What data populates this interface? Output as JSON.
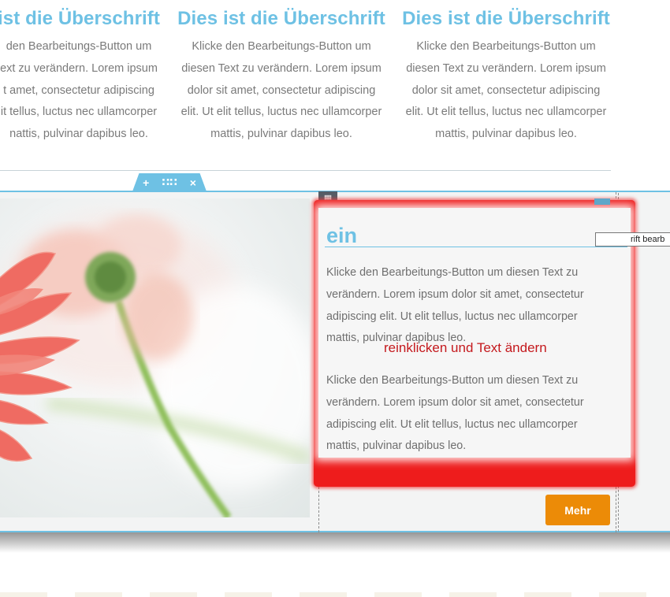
{
  "top_columns": [
    {
      "heading": "ist die Überschrift",
      "lines": [
        "den Bearbeitungs-Button um",
        "ext zu verändern. Lorem ipsum",
        "t amet, consectetur adipiscing",
        "it tellus, luctus nec ullamcorper",
        "nattis, pulvinar dapibus leo."
      ]
    },
    {
      "heading": "Dies ist die Überschrift",
      "lines": [
        "Klicke den Bearbeitungs-Button um",
        "diesen Text zu verändern. Lorem ipsum",
        "dolor sit amet, consectetur adipiscing",
        "elit. Ut elit tellus, luctus nec ullamcorper",
        "mattis, pulvinar dapibus leo."
      ]
    },
    {
      "heading": "Dies ist die Überschrift",
      "lines": [
        "Klicke den Bearbeitungs-Button um",
        "diesen Text zu verändern. Lorem ipsum",
        "dolor sit amet, consectetur adipiscing",
        "elit. Ut elit tellus, luctus nec ullamcorper",
        "mattis, pulvinar dapibus leo."
      ]
    }
  ],
  "section_handle": {
    "add": "+",
    "move": "∷∷",
    "delete": "×"
  },
  "column_handle_label": "▦",
  "editor": {
    "heading_fragment": "ein",
    "tooltip": "rift bearb",
    "paragraph_1": "Klicke den Bearbeitungs-Button um diesen Text zu verändern. Lorem ipsum dolor sit amet, consectetur adipiscing elit. Ut elit tellus, luctus nec ullamcorper mattis, pulvinar dapibus leo.",
    "paragraph_2": "Klicke den Bearbeitungs-Button um diesen Text zu verändern. Lorem ipsum dolor sit amet, consectetur adipiscing elit. Ut elit tellus, luctus nec ullamcorper mattis, pulvinar dapibus leo.",
    "annotation": "reinklicken und Text ändern"
  },
  "button": {
    "label": "Mehr"
  },
  "colors": {
    "accent": "#6ec1e4",
    "highlight": "#ee1c1c",
    "button": "#ec8b07",
    "annotation_text": "#c4191d"
  }
}
